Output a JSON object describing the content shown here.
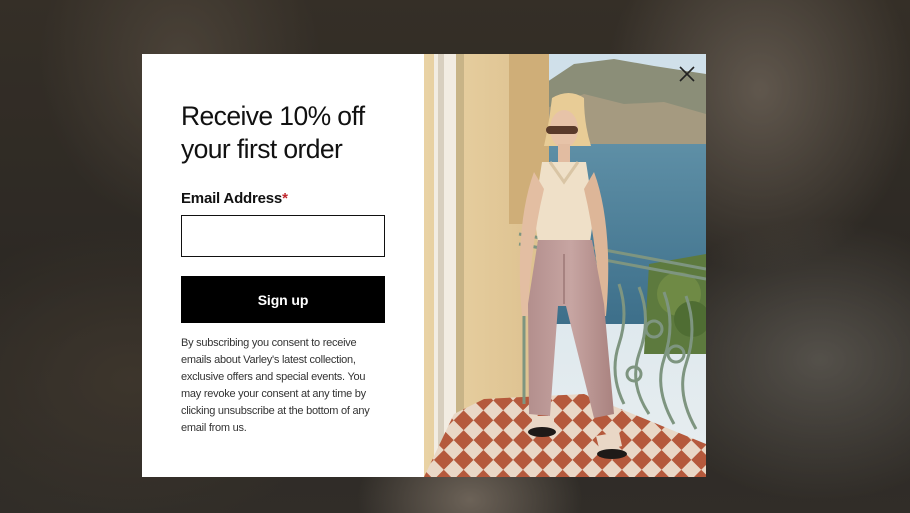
{
  "modal": {
    "headline_line1": "Receive 10% off",
    "headline_line2": "your first order",
    "email_label": "Email Address",
    "required_mark": "*",
    "email_value": "",
    "signup_label": "Sign up",
    "consent_text": "By subscribing you consent to receive emails about Varley's latest collection, exclusive offers and special events. You may revoke your consent at any time by clicking unsubscribe at the bottom of any email from us.",
    "close_icon": "close-icon"
  },
  "colors": {
    "button": "#000000",
    "required": "#c0272d",
    "panel": "#ffffff"
  }
}
